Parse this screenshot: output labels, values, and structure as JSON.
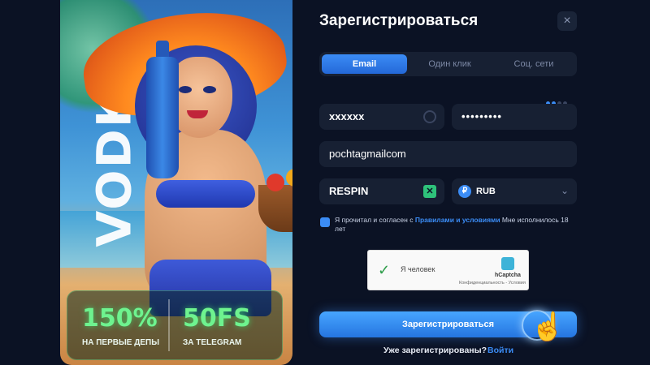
{
  "promo": {
    "brand": "VODKA",
    "bonus_left_big": "150%",
    "bonus_left_small": "НА ПЕРВЫЕ ДЕПЫ",
    "bonus_right_big": "50FS",
    "bonus_right_small": "ЗА TELEGRAM"
  },
  "form": {
    "title": "Зарегистрироваться",
    "close_icon": "×",
    "tabs": [
      {
        "label": "Email",
        "active": true
      },
      {
        "label": "Один клик",
        "active": false
      },
      {
        "label": "Соц. сети",
        "active": false
      }
    ],
    "step_indicator": {
      "total": 4,
      "current": 1
    },
    "login_value": "xxxxxx",
    "password_value": "•••••••••",
    "email_value": "pochtagmailcom",
    "promo_code_value": "RESPIN",
    "currency_value": "RUB",
    "currency_symbol": "₽",
    "agree_text_prefix": "Я прочитал и согласен с ",
    "agree_link": "Правилами и условиями",
    "agree_text_suffix": " Мне исполнилось 18 лет",
    "captcha": {
      "label": "Я человек",
      "brand": "hCaptcha",
      "sub": "Конфиденциальность - Условия"
    },
    "submit_label": "Зарегистрироваться",
    "already_question": "Уже зарегистрированы?",
    "login_link": "Войти"
  },
  "colors": {
    "background": "#0b1224",
    "accent": "#3b8cf5",
    "field_bg": "#172033",
    "bonus_green": "#6ef38f"
  }
}
